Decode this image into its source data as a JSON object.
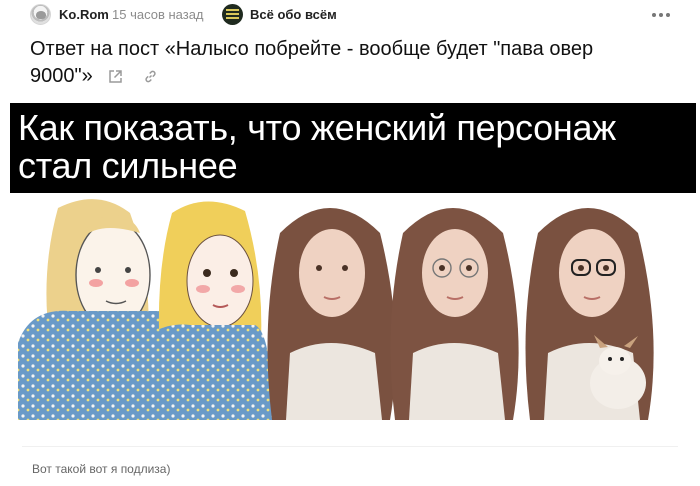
{
  "post": {
    "author": "Ko.Rom",
    "time": "15 часов назад",
    "community": "Всё обо всём",
    "title": "Ответ на пост «Налысо побрейте - вообще будет \"пава овер 9000\"»",
    "image_text": "Как показать, что женский персонаж стал сильнее",
    "caption": "Вот такой вот я подлиза)"
  },
  "icons": {
    "more": "more-dots-icon",
    "external": "external-link-icon",
    "link": "link-icon"
  },
  "colors": {
    "muted": "#8c8c8c",
    "banner_bg": "#000000",
    "banner_text": "#ffffff"
  }
}
